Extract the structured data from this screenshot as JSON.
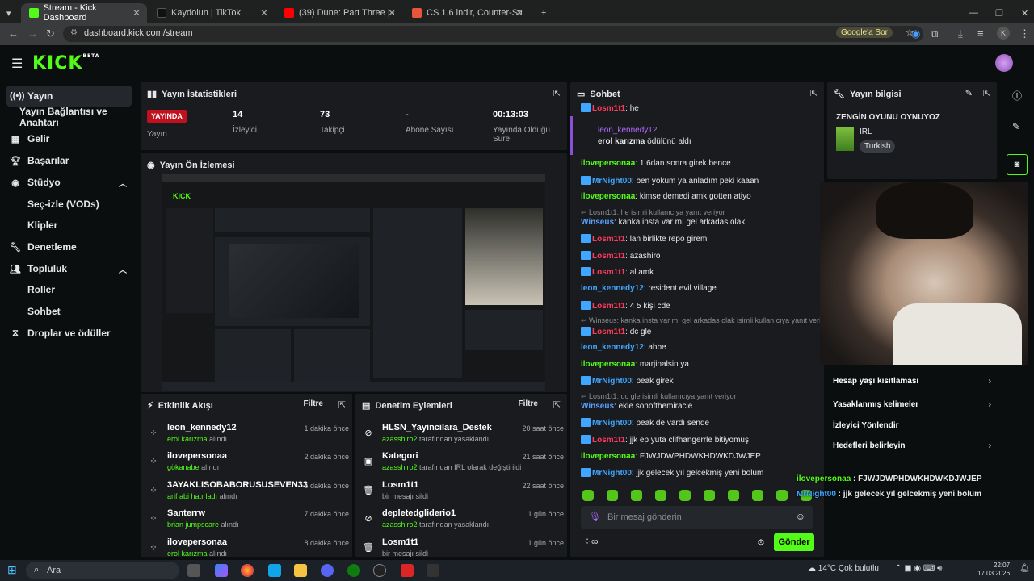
{
  "browser": {
    "tabs": [
      {
        "title": "Stream - Kick Dashboard",
        "active": true
      },
      {
        "title": "Kaydolun | TikTok"
      },
      {
        "title": "(39) Dune: Part Three | Official"
      },
      {
        "title": "CS 1.6 indir, Counter-Strike 1.6"
      }
    ],
    "url": "dashboard.kick.com/stream",
    "google_btn": "Google'a Sor",
    "profile": "K"
  },
  "sidebar": {
    "items": [
      {
        "label": "Yayın",
        "active": true
      },
      {
        "label": "Yayın Bağlantısı ve Anahtarı"
      },
      {
        "label": "Gelir"
      },
      {
        "label": "Başarılar"
      },
      {
        "label": "Stüdyo"
      },
      {
        "label": "Seç-izle (VODs)"
      },
      {
        "label": "Klipler"
      },
      {
        "label": "Denetleme"
      },
      {
        "label": "Topluluk"
      },
      {
        "label": "Roller"
      },
      {
        "label": "Sohbet"
      },
      {
        "label": "Droplar ve ödüller"
      }
    ]
  },
  "stats": {
    "title": "Yayın İstatistikleri",
    "live_badge": "YAYINDA",
    "status_label": "Yayın",
    "viewers": "14",
    "viewers_label": "İzleyici",
    "followers": "73",
    "followers_label": "Takipçi",
    "subs": "-",
    "subs_label": "Abone Sayısı",
    "duration": "00:13:03",
    "duration_label_1": "Yayında Olduğu",
    "duration_label_2": "Süre"
  },
  "preview": {
    "title": "Yayın Ön İzlemesi"
  },
  "activity": {
    "title": "Etkinlik Akışı",
    "filter": "Filtre",
    "rows": [
      {
        "name": "leon_kennedy12",
        "reward": "erol karızma",
        "action": "alındı",
        "time": "1 dakika önce"
      },
      {
        "name": "ilovepersonaa",
        "reward": "gökanabe",
        "action": "alındı",
        "time": "2 dakika önce"
      },
      {
        "name": "3AYAKLISOBABORUSUSEVEN33",
        "reward": "arif abi hatırladı",
        "action": "alındı",
        "time": "5 dakika önce"
      },
      {
        "name": "Santerrw",
        "reward": "brian jumpscare",
        "action": "alındı",
        "time": "7 dakika önce"
      },
      {
        "name": "ilovepersonaa",
        "reward": "erol karızma",
        "action": "alındı",
        "time": "8 dakika önce"
      }
    ]
  },
  "moderation": {
    "title": "Denetim Eylemleri",
    "filter": "Filtre",
    "rows": [
      {
        "name": "HLSN_Yayincilara_Destek",
        "by": "azasshiro2",
        "detail": "tarafından yasaklandı",
        "time": "20 saat önce"
      },
      {
        "name": "Kategori",
        "by": "azasshiro2",
        "detail": "tarafından IRL olarak değiştirildi",
        "time": "21 saat önce"
      },
      {
        "name": "Losm1t1",
        "by": "",
        "detail": "bir mesajı sildi",
        "time": "22 saat önce"
      },
      {
        "name": "depletedgliderio1",
        "by": "azasshiro2",
        "detail": "tarafından yasaklandı",
        "time": "1 gün önce"
      },
      {
        "name": "Losm1t1",
        "by": "",
        "detail": "bir mesajı sildi",
        "time": "1 gün önce"
      }
    ]
  },
  "chat": {
    "title": "Sohbet",
    "redeem": {
      "user": "leon_kennedy12",
      "reward": "erol karızma",
      "text": "ödülünü aldı"
    },
    "messages": [
      {
        "user": "Losm1t1",
        "text": "he"
      },
      {
        "user": "ilovepersonaa",
        "text": "1.6dan sonra girek bence"
      },
      {
        "user": "MrNight00",
        "text": "ben yokum ya anladım peki kaaan"
      },
      {
        "user": "ilovepersonaa",
        "text": "kimse demedi amk gotten atiyo"
      },
      {
        "reply": "Losm1t1: he isimli kullanıcıya yanıt veriyor"
      },
      {
        "user": "Winseus",
        "text": "kanka insta var mı gel arkadas olak"
      },
      {
        "user": "Losm1t1",
        "text": "lan birlikte repo girem"
      },
      {
        "user": "Losm1t1",
        "text": "azashiro"
      },
      {
        "user": "Losm1t1",
        "text": "al amk"
      },
      {
        "user": "leon_kennedy12",
        "text": "resident evil village"
      },
      {
        "user": "Losm1t1",
        "text": "4 5 kişi cde"
      },
      {
        "reply": "Winseus: kanka insta var mı gel arkadas olak isimli kullanıcıya yanıt veriyor"
      },
      {
        "user": "Losm1t1",
        "text": "dc gle"
      },
      {
        "user": "leon_kennedy12",
        "text": "ahbe"
      },
      {
        "user": "ilovepersonaa",
        "text": "marjinalsin ya"
      },
      {
        "user": "MrNight00",
        "text": "peak girek"
      },
      {
        "reply": "Losm1t1: dc gle isimli kullanıcıya yanıt veriyor"
      },
      {
        "user": "Winseus",
        "text": "ekle sonofthemiracle"
      },
      {
        "user": "MrNight00",
        "text": "peak de vardı sende"
      },
      {
        "user": "Losm1t1",
        "text": "jjk ep yuta clifhangerrle bitiyomuş"
      },
      {
        "user": "ilovepersonaa",
        "text": "FJWJDWPHDWKHDWKDJWJEP"
      },
      {
        "user": "MrNight00",
        "text": "jjk gelecek yıl gelcekmiş yeni bölüm"
      }
    ],
    "placeholder": "Bir mesaj gönderin",
    "send": "Gönder",
    "colors": {
      "Losm1t1": "#ff3b5c",
      "ilovepersonaa": "#53fc18",
      "MrNight00": "#3fa7ff",
      "Winseus": "#5aa0ff",
      "leon_kennedy12": "#3fa7ff"
    }
  },
  "stream_info": {
    "title": "Yayın bilgisi",
    "stream_title": "ZENGİN OYUNU OYNUYOZ",
    "category": "IRL",
    "language": "Turkish",
    "links": [
      "Hesap yaşı kısıtlaması",
      "Yasaklanmış kelimeler",
      "İzleyici Yönlendir",
      "Hedefleri belirleyin"
    ]
  },
  "overlay": {
    "line1_user": "ilovepersonaa",
    "line1_text": "FJWJDWPHDWKHDWKDJWJEP",
    "line2_user": "MrNight00",
    "line2_text": "jjk gelecek yıl gelcekmiş yeni bölüm"
  },
  "taskbar": {
    "search": "Ara",
    "weather": "14°C  Çok bulutlu",
    "time": "22:07",
    "date": "17.03.2026"
  }
}
